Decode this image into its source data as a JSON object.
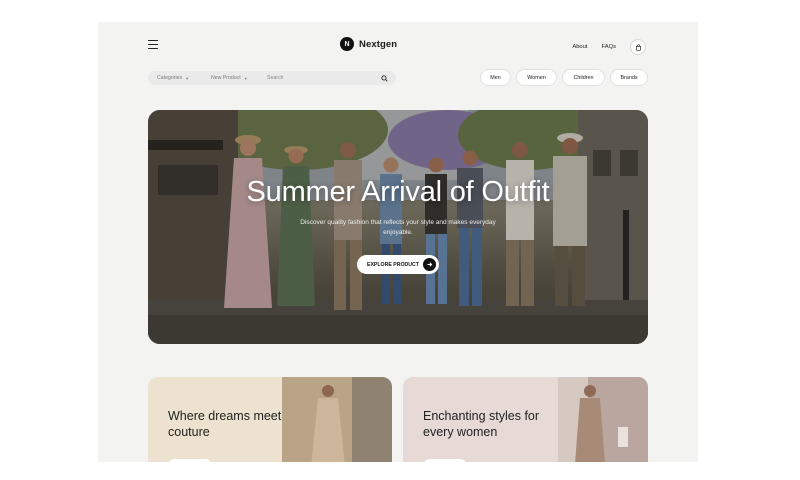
{
  "brand": {
    "logo_letter": "N",
    "name": "Nextgen"
  },
  "nav": {
    "about": "About",
    "faqs": "FAQs"
  },
  "search_bar": {
    "categories_label": "Categories",
    "new_product_label": "New Product",
    "search_placeholder": "Search"
  },
  "category_chips": [
    "Men",
    "Women",
    "Children",
    "Brands"
  ],
  "hero": {
    "title": "Summer Arrival of Outfit",
    "subtitle": "Discover quality fashion that reflects your style and makes everyday enjoyable.",
    "cta_label": "EXPLORE PRODUCT"
  },
  "promo_cards": [
    {
      "title": "Where dreams meet couture"
    },
    {
      "title": "Enchanting styles for every women"
    }
  ],
  "icons": {
    "menu": "hamburger-icon",
    "bag": "shopping-bag-icon",
    "search": "search-icon",
    "arrow": "arrow-right-icon",
    "caret": "chevron-down-icon"
  },
  "colors": {
    "page_bg": "#f3f3f2",
    "accent_dark": "#111111",
    "card_1_bg": "#ece2cf",
    "card_2_bg": "#e7d9d6"
  }
}
